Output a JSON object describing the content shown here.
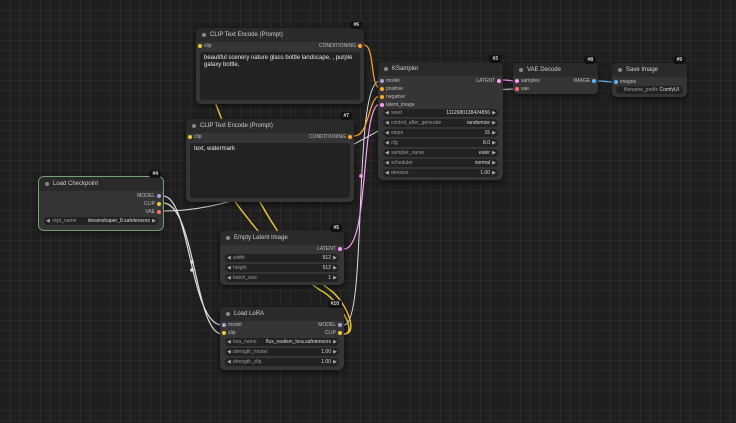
{
  "colors": {
    "clip": "#f0c83c",
    "conditioning": "#ffa931",
    "model": "#b39ddb",
    "vae": "#ff6e6e",
    "latent": "#ff9cf9",
    "image": "#64b5f6",
    "link_white": "#dddddd"
  },
  "nodes": {
    "clip_pos": {
      "id": "#6",
      "title": "CLIP Text Encode (Prompt)",
      "input_clip": "clip",
      "output": "CONDITIONING",
      "text": "beautiful scenery nature glass bottle landscape, , purple galaxy bottle,"
    },
    "clip_neg": {
      "id": "#7",
      "title": "CLIP Text Encode (Prompt)",
      "input_clip": "clip",
      "output": "CONDITIONING",
      "text": "text, watermark"
    },
    "ksampler": {
      "id": "#3",
      "title": "KSampler",
      "inputs": [
        "model",
        "positive",
        "negative",
        "latent_image"
      ],
      "output": "LATENT",
      "widgets": [
        {
          "label": "seed",
          "value": "1112680138424856"
        },
        {
          "label": "control_after_generate",
          "value": "randomize"
        },
        {
          "label": "steps",
          "value": "15"
        },
        {
          "label": "cfg",
          "value": "8.0"
        },
        {
          "label": "sampler_name",
          "value": "euler"
        },
        {
          "label": "scheduler",
          "value": "normal"
        },
        {
          "label": "denoise",
          "value": "1.00"
        }
      ]
    },
    "vae_decode": {
      "id": "#8",
      "title": "VAE Decode",
      "inputs": [
        "samples",
        "vae"
      ],
      "output": "IMAGE"
    },
    "save_image": {
      "id": "#9",
      "title": "Save Image",
      "input": "images",
      "widget": {
        "label": "filename_prefix",
        "value": "ComfyUI"
      }
    },
    "checkpoint": {
      "id": "#4",
      "title": "Load Checkpoint",
      "outputs": [
        "MODEL",
        "CLIP",
        "VAE"
      ],
      "widget": {
        "label": "ckpt_name",
        "value": "dreamshaper_8.safetensors"
      }
    },
    "latent": {
      "id": "#5",
      "title": "Empty Latent Image",
      "output": "LATENT",
      "widgets": [
        {
          "label": "width",
          "value": "512"
        },
        {
          "label": "height",
          "value": "512"
        },
        {
          "label": "batch_size",
          "value": "1"
        }
      ]
    },
    "lora": {
      "id": "#10",
      "title": "Load LoRA",
      "inputs": [
        "model",
        "clip"
      ],
      "outputs": [
        "MODEL",
        "CLIP"
      ],
      "widgets": [
        {
          "label": "lora_name",
          "value": "flux_realism_lora.safetensors"
        },
        {
          "label": "strength_model",
          "value": "1.00"
        },
        {
          "label": "strength_clip",
          "value": "1.00"
        }
      ]
    }
  }
}
